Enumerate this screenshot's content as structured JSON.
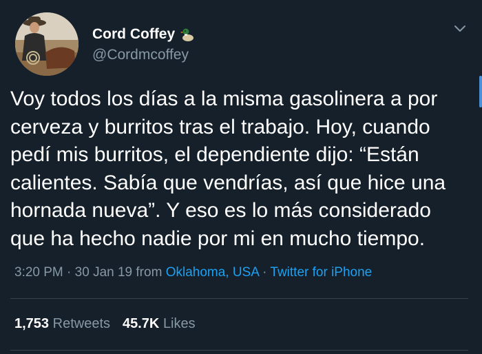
{
  "author": {
    "name": "Cord Coffey",
    "handle": "@Cordmcoffey",
    "name_badge_icon": "duck-emoji-icon"
  },
  "tweet": {
    "lines": [
      "Voy todos los días a la misma gasolinera a por",
      "cerveza y burritos tras el trabajo. Hoy, cuando",
      "pedí mis burritos, el dependiente dijo: “Están",
      "calientes. Sabía que vendrías, así que hice una",
      "hornada nueva”. Y eso es lo más considerado",
      "que ha hecho nadie por mi en mucho tiempo."
    ]
  },
  "meta": {
    "time": "3:20 PM",
    "separator1": " · ",
    "date": "30 Jan 19",
    "from_label": " from ",
    "location": "Oklahoma, USA",
    "separator2": " · ",
    "source": "Twitter for iPhone"
  },
  "stats": {
    "retweets_count": "1,753",
    "retweets_label": "Retweets",
    "likes_count": "45.7K",
    "likes_label": "Likes"
  },
  "colors": {
    "background": "#15202b",
    "text": "#ffffff",
    "secondary": "#8899a6",
    "link": "#1da1f2",
    "divider": "#38444d"
  }
}
